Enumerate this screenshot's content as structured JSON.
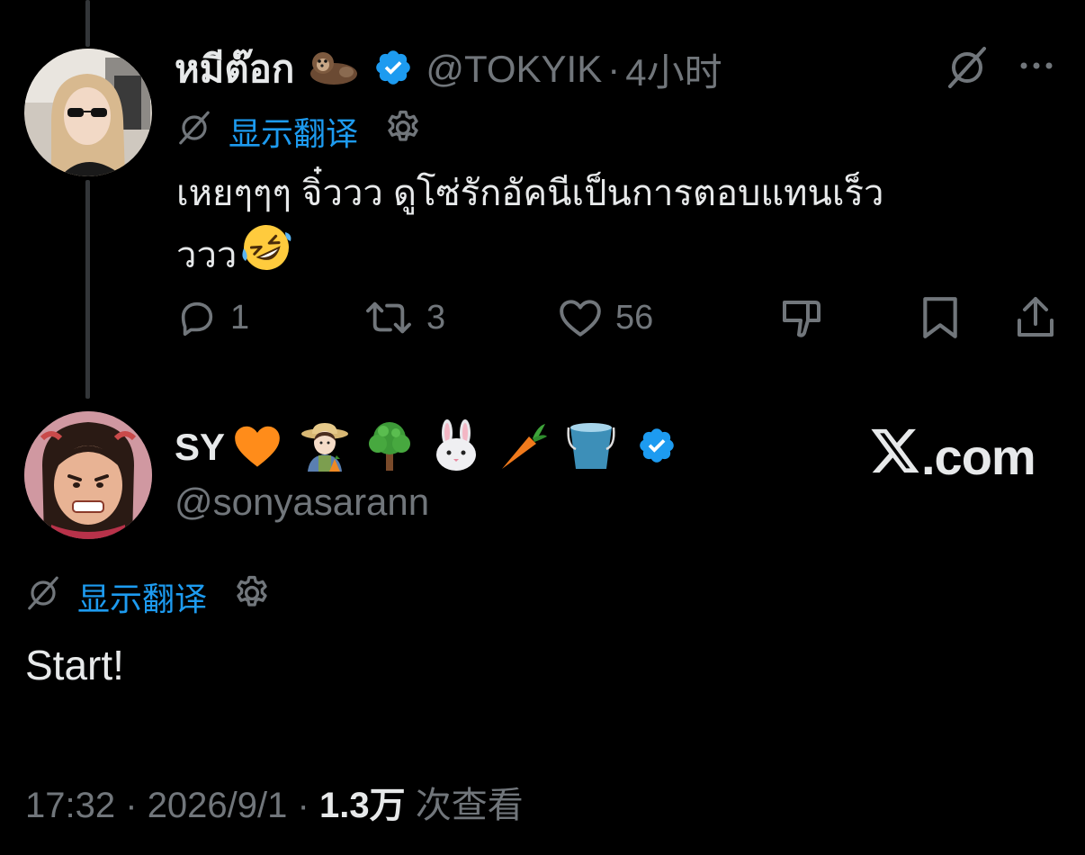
{
  "reply_to_post": {
    "display_name": "หมีต๊อก",
    "name_emoji": "otter",
    "handle": "@TOKYIK",
    "separator": "·",
    "time": "4小时",
    "translate_label": "显示翻译",
    "text_line1": "เหยๆๆๆ จิ๋ววว ดูโซ่รักอัคนีเป็นการตอบแทนเร็ว",
    "text_line2": "ววว",
    "text_emoji": "rolling-on-floor-laughing",
    "actions": {
      "reply_count": "1",
      "repost_count": "3",
      "like_count": "56"
    }
  },
  "main_post": {
    "display_name": "SY",
    "name_emojis": [
      "orange-heart",
      "farmer",
      "tree",
      "rabbit",
      "carrot",
      "bucket"
    ],
    "handle": "@sonyasarann",
    "translate_label": "显示翻译",
    "text": "Start!",
    "footer": {
      "time": "17:32",
      "separator1": "·",
      "date": "2026/9/1",
      "separator2": "·",
      "views": "1.3万",
      "views_label": "次查看"
    }
  },
  "watermark": {
    "x_logo": "𝕏",
    "domain": ".com"
  },
  "colors": {
    "background": "#000000",
    "primary_text": "#e7e9ea",
    "secondary_text": "#71767b",
    "accent_blue": "#1d9bf0",
    "thread_line": "#333639"
  }
}
